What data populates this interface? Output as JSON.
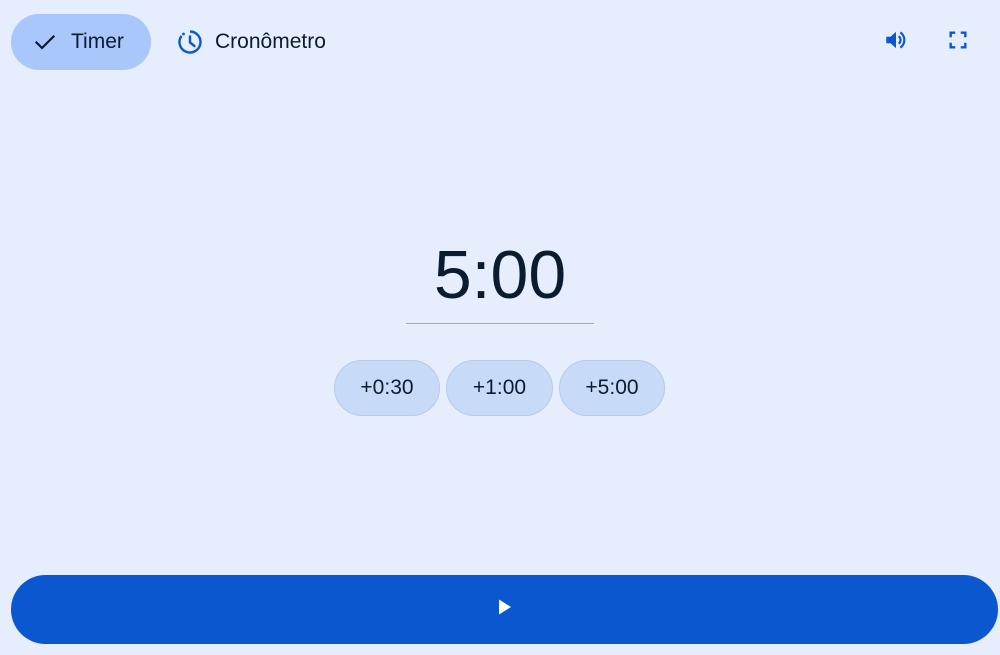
{
  "tabs": {
    "timer": {
      "label": "Timer",
      "icon": "check-icon",
      "selected": true
    },
    "stopwatch": {
      "label": "Cronômetro",
      "icon": "stopwatch-icon",
      "selected": false
    }
  },
  "toolbar": {
    "volume_icon": "volume-icon",
    "fullscreen_icon": "fullscreen-icon"
  },
  "timer": {
    "display": "5:00"
  },
  "quick_add": [
    {
      "label": "+0:30"
    },
    {
      "label": "+1:00"
    },
    {
      "label": "+5:00"
    }
  ],
  "start_button": {
    "icon": "play-icon"
  },
  "colors": {
    "background": "#e6edfc",
    "selected_tab": "#a9c7fa",
    "chip": "#c7daf7",
    "primary": "#0b57d0",
    "text": "#0b1c30"
  }
}
